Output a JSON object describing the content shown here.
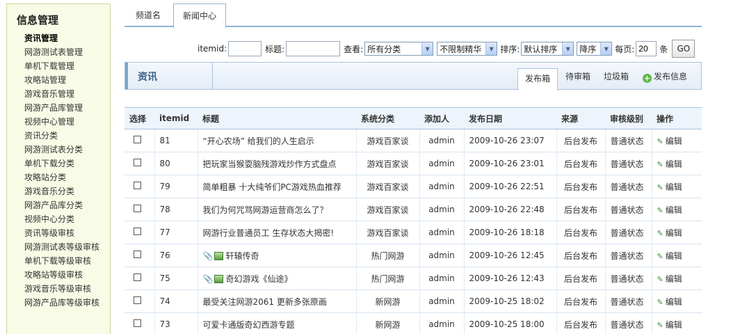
{
  "sidebar": {
    "title": "信息管理",
    "items": [
      "资讯管理",
      "网游测试表管理",
      "单机下载管理",
      "攻略站管理",
      "游戏音乐管理",
      "网游产品库管理",
      "视频中心管理",
      "资讯分类",
      "网游测试表分类",
      "单机下载分类",
      "攻略站分类",
      "游戏音乐分类",
      "网游产品库分类",
      "视频中心分类",
      "资讯等级审核",
      "网游测试表等级审核",
      "单机下载等级审核",
      "攻略站等级审核",
      "游戏音乐等级审核",
      "网游产品库等级审核"
    ]
  },
  "tabs": {
    "channel": "频道名",
    "news": "新闻中心"
  },
  "filter": {
    "itemid_label": "itemid:",
    "title_label": "标题:",
    "view_label": "查看:",
    "category_value": "所有分类",
    "essence_value": "不限制精华",
    "sort_label": "排序:",
    "sort_value": "默认排序",
    "order_value": "降序",
    "per_page_label": "每页:",
    "per_page_value": "20",
    "unit": "条",
    "go": "GO"
  },
  "section": {
    "title": "资讯",
    "tabs": [
      "发布箱",
      "待审箱",
      "垃圾箱"
    ],
    "publish": "发布信息"
  },
  "table": {
    "headers": [
      "选择",
      "itemid",
      "标题",
      "系统分类",
      "添加人",
      "发布日期",
      "来源",
      "审核级别",
      "操作"
    ],
    "rows": [
      {
        "id": "81",
        "title": "“开心农场” 给我们的人生启示",
        "cat": "游戏百家谈",
        "user": "admin",
        "date": "2009-10-26 23:07",
        "src": "后台发布",
        "level": "普通状态",
        "op": "编辑"
      },
      {
        "id": "80",
        "title": "把玩家当猴耍脑残游戏炒作方式盘点",
        "cat": "游戏百家谈",
        "user": "admin",
        "date": "2009-10-26 23:01",
        "src": "后台发布",
        "level": "普通状态",
        "op": "编辑"
      },
      {
        "id": "79",
        "title": "简单粗暴 十大纯爷们PC游戏热血推荐",
        "cat": "游戏百家谈",
        "user": "admin",
        "date": "2009-10-26 22:51",
        "src": "后台发布",
        "level": "普通状态",
        "op": "编辑"
      },
      {
        "id": "78",
        "title": "我们为何咒骂网游运营商怎么了？",
        "cat": "游戏百家谈",
        "user": "admin",
        "date": "2009-10-26 22:48",
        "src": "后台发布",
        "level": "普通状态",
        "op": "编辑"
      },
      {
        "id": "77",
        "title": "网游行业普通员工 生存状态大揭密!",
        "cat": "游戏百家谈",
        "user": "admin",
        "date": "2009-10-26 18:18",
        "src": "后台发布",
        "level": "普通状态",
        "op": "编辑"
      },
      {
        "id": "76",
        "title": "轩辕传奇",
        "cat": "热门网游",
        "user": "admin",
        "date": "2009-10-26 12:45",
        "src": "后台发布",
        "level": "普通状态",
        "op": "编辑"
      },
      {
        "id": "75",
        "title": "奇幻游戏《仙途》",
        "cat": "热门网游",
        "user": "admin",
        "date": "2009-10-26 12:43",
        "src": "后台发布",
        "level": "普通状态",
        "op": "编辑"
      },
      {
        "id": "74",
        "title": "最受关注网游2061 更新多张原画",
        "cat": "新网游",
        "user": "admin",
        "date": "2009-10-25 18:02",
        "src": "后台发布",
        "level": "普通状态",
        "op": "编辑"
      },
      {
        "id": "73",
        "title": "可爱卡通版奇幻西游专题",
        "cat": "新网游",
        "user": "admin",
        "date": "2009-10-25 18:00",
        "src": "后台发布",
        "level": "普通状态",
        "op": "编辑"
      }
    ]
  }
}
